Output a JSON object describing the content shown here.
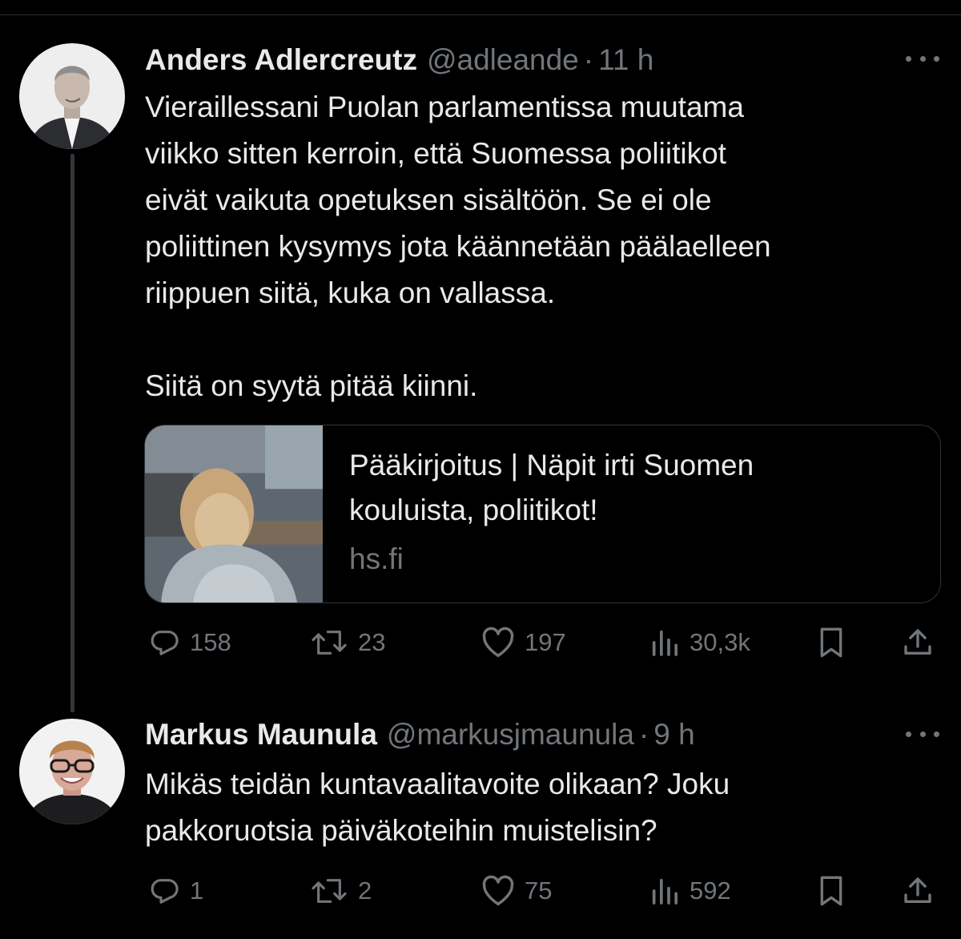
{
  "tweets": [
    {
      "name": "Anders Adlercreutz",
      "handle": "@adleande",
      "dot": "·",
      "time": "11 h",
      "text": "Vieraillessani Puolan parlamentissa muutama\nviikko sitten kerroin, että Suomessa poliitikot\neivät vaikuta opetuksen sisältöön. Se ei ole\npoliittinen kysymys jota käännetään päälaelleen\nriippuen siitä, kuka on vallassa.\n\nSiitä on syytä pitää kiinni.",
      "card": {
        "title": "Pääkirjoitus | Näpit irti Suomen\nkouluista, poliitikot!",
        "domain": "hs.fi"
      },
      "stats": {
        "replies": "158",
        "reposts": "23",
        "likes": "197",
        "views": "30,3k"
      }
    },
    {
      "name": "Markus Maunula",
      "handle": "@markusjmaunula",
      "dot": "·",
      "time": "9 h",
      "text": "Mikäs teidän kuntavaalitavoite olikaan? Joku\npakkoruotsia päiväkoteihin muistelisin?",
      "stats": {
        "replies": "1",
        "reposts": "2",
        "likes": "75",
        "views": "592"
      }
    }
  ],
  "icons": {
    "reply": "reply-icon",
    "repost": "repost-icon",
    "like": "heart-icon",
    "views": "views-icon",
    "bookmark": "bookmark-icon",
    "share": "share-icon",
    "more": "more-icon"
  },
  "colors": {
    "background": "#000000",
    "text_primary": "#e7e9ea",
    "text_secondary": "#71767b",
    "border": "#2f3336"
  }
}
